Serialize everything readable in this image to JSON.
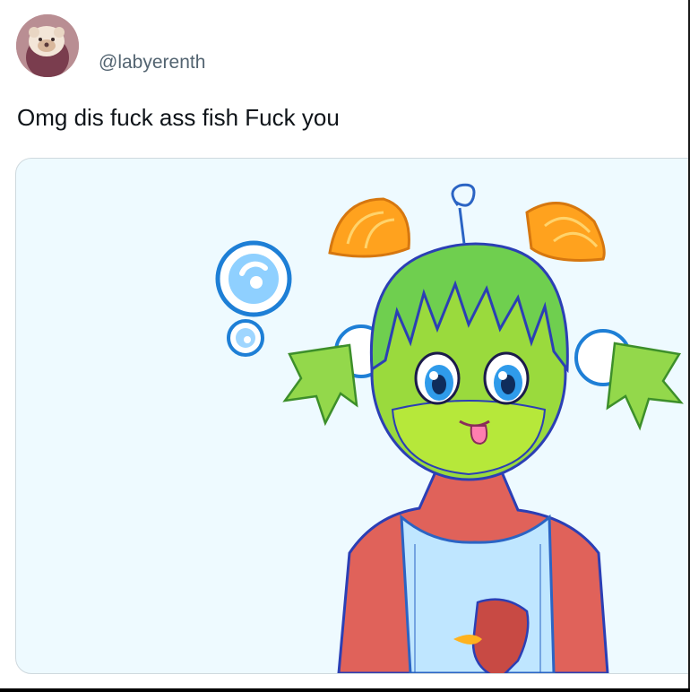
{
  "tweet": {
    "handle": "@labyerenth",
    "text": "Omg dis fuck ass fish Fuck you"
  },
  "colors": {
    "handle_text": "#536471",
    "body_text": "#0f1419",
    "media_background": "#eefaff",
    "media_border": "#cfd9de"
  }
}
